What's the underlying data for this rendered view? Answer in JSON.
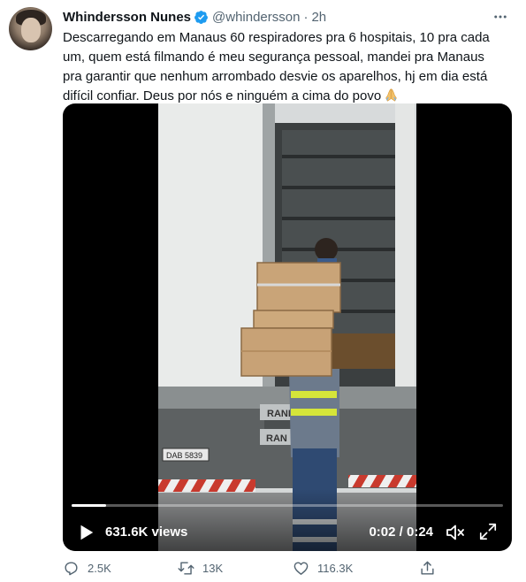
{
  "tweet": {
    "author_name": "Whindersson Nunes",
    "handle": "@whindersson",
    "separator": "·",
    "time": "2h",
    "text": "Descarregando em Manaus 60 respiradores pra 6 hospitais, 10 pra cada\num, quem está filmando é meu segurança pessoal, mandei pra Manaus\npra garantir que nenhum arrombado desvie os aparelhos, hj em dia está\ndifícil confiar. Deus por nós e ninguém a cima do povo",
    "emoji": "folded-hands-emoji"
  },
  "video": {
    "views": "631.6K views",
    "time": "0:02 / 0:24",
    "progress_fraction": 0.08,
    "scene_text": {
      "truck_badge_1": "RAND",
      "truck_badge_2": "RAN",
      "plate": "DAB 5839"
    }
  },
  "actions": {
    "reply_count": "2.5K",
    "retweet_count": "13K",
    "like_count": "116.3K"
  },
  "colors": {
    "verified": "#1d9bf0",
    "secondary_text": "#536471",
    "video_bg": "#000000"
  }
}
